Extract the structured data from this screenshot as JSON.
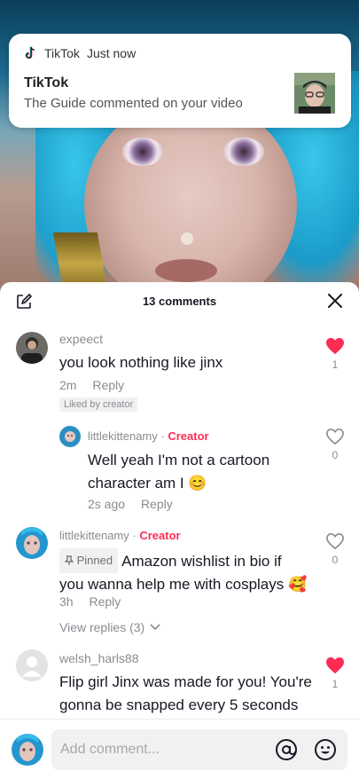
{
  "notification": {
    "app_name": "TikTok",
    "time": "Just now",
    "title": "TikTok",
    "body": "The Guide commented on your video",
    "thumb_icon": "user-photo"
  },
  "sheet": {
    "title": "13 comments",
    "edit_icon": "edit-icon",
    "close_icon": "close-icon"
  },
  "comments": [
    {
      "username": "expeect",
      "text": "you look nothing like jinx",
      "time": "2m",
      "reply_label": "Reply",
      "badge": "Liked by creator",
      "likes": "1",
      "liked": true
    },
    {
      "username": "littlekittenamy",
      "creator_label": "Creator",
      "text_line1": "Well yeah I'm not a cartoon",
      "text_line2": "character am I",
      "emoji": "😊",
      "time": "2s ago",
      "reply_label": "Reply",
      "likes": "0",
      "liked": false
    },
    {
      "username": "littlekittenamy",
      "creator_label": "Creator",
      "pinned_label": "Pinned",
      "text_line1": "Amazon wishlist in bio if",
      "text_line2": "you wanna help me with cosplays",
      "emoji": "🥰",
      "time": "3h",
      "reply_label": "Reply",
      "view_replies": "View replies (3)",
      "likes": "0",
      "liked": false
    },
    {
      "username": "welsh_harls88",
      "text_line1": "Flip girl Jinx was made for you! You're",
      "text_line2": "gonna be snapped every 5 seconds",
      "likes": "1",
      "liked": true
    }
  ],
  "input": {
    "placeholder": "Add comment...",
    "at_icon": "at-icon",
    "emoji_icon": "emoji-icon"
  },
  "colors": {
    "like_red": "#fe2c55",
    "creator_red": "#fe2c55",
    "muted_gray": "#8a8b91"
  }
}
